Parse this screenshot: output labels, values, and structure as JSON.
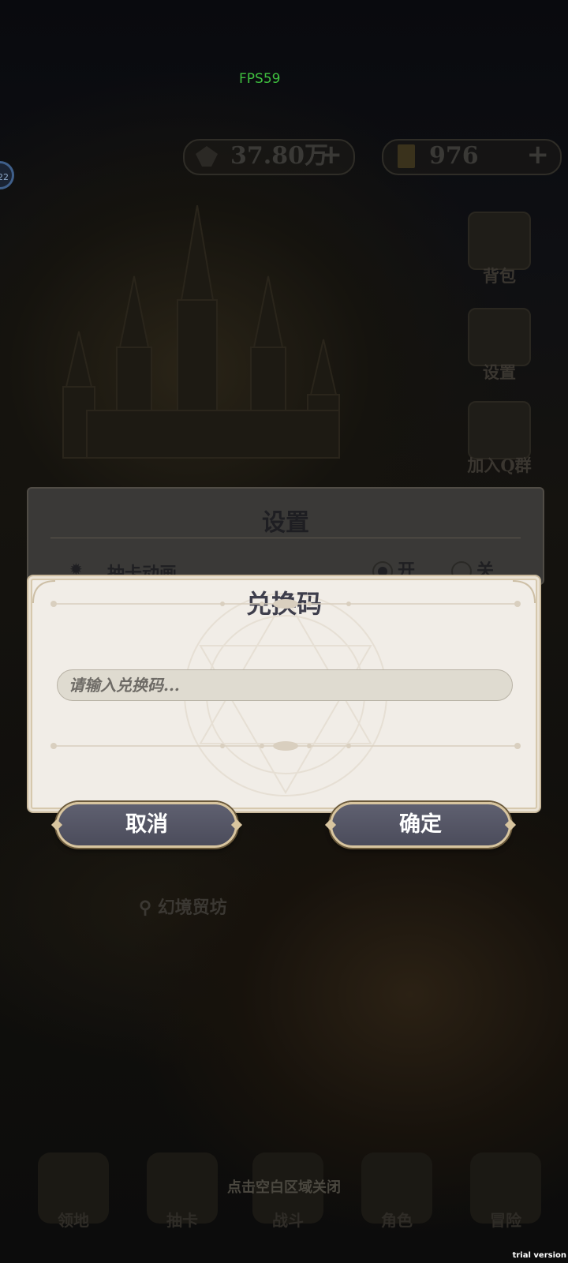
{
  "hud": {
    "fps": "FPS59",
    "left_badge": "22",
    "currency_1": {
      "value": "37.80万",
      "plus": "+",
      "icon": "crystal-icon"
    },
    "currency_2": {
      "value": "976",
      "plus": "+",
      "icon": "ticket-icon"
    }
  },
  "side_menu": [
    {
      "label": "背包",
      "icon": "backpack-icon"
    },
    {
      "label": "设置",
      "icon": "gear-icon"
    },
    {
      "label": "加入Q群",
      "icon": "qq-penguin-icon"
    }
  ],
  "location_label": "幻境贸坊",
  "close_hint": "点击空白区域关闭",
  "tabs": [
    {
      "label": "领地"
    },
    {
      "label": "抽卡"
    },
    {
      "label": "战斗"
    },
    {
      "label": "角色"
    },
    {
      "label": "冒险"
    }
  ],
  "settings_dialog": {
    "title": "设置",
    "row_label": "抽卡动画",
    "option_on": "开",
    "option_off": "关",
    "selected": "开"
  },
  "redeem_dialog": {
    "title": "兑换码",
    "input_placeholder": "请输入兑换码...",
    "input_value": "",
    "cancel_label": "取消",
    "confirm_label": "确定"
  },
  "watermark": "trial version",
  "colors": {
    "dialog_bg": "#f1ede7",
    "button_bg": "#555666",
    "button_border": "#d8c59f",
    "fps_text": "#3fbf3f"
  }
}
